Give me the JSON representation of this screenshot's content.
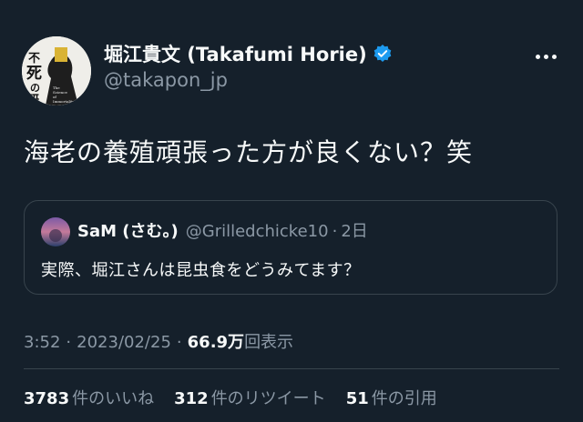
{
  "author": {
    "name": "堀江貴文 (Takafumi Horie)",
    "handle": "@takapon_jp",
    "avatar_text": "死の研究",
    "avatar_subtext": "The Science of Immortality"
  },
  "tweet": {
    "text": "海老の養殖頑張った方が良くない？笑"
  },
  "quoted": {
    "name": "SaM (さむ。)",
    "handle": "@Grilledchicke10",
    "separator": "·",
    "time": "2日",
    "text": "実際、堀江さんは昆虫食をどうみてます？"
  },
  "meta": {
    "time": "3:52",
    "separator": "·",
    "date": "2023/02/25",
    "views_count": "66.9万",
    "views_label": "回表示"
  },
  "stats": {
    "likes_count": "3783",
    "likes_label": "件のいいね",
    "retweets_count": "312",
    "retweets_label": "件のリツイート",
    "quotes_count": "51",
    "quotes_label": "件の引用"
  },
  "colors": {
    "background": "#15202b",
    "text": "#f7f9f9",
    "secondary_text": "#8b98a5",
    "border": "#38444d",
    "verified": "#1d9bf0"
  },
  "icons": {
    "verified": "verified-badge-icon",
    "more": "more-options-icon"
  }
}
